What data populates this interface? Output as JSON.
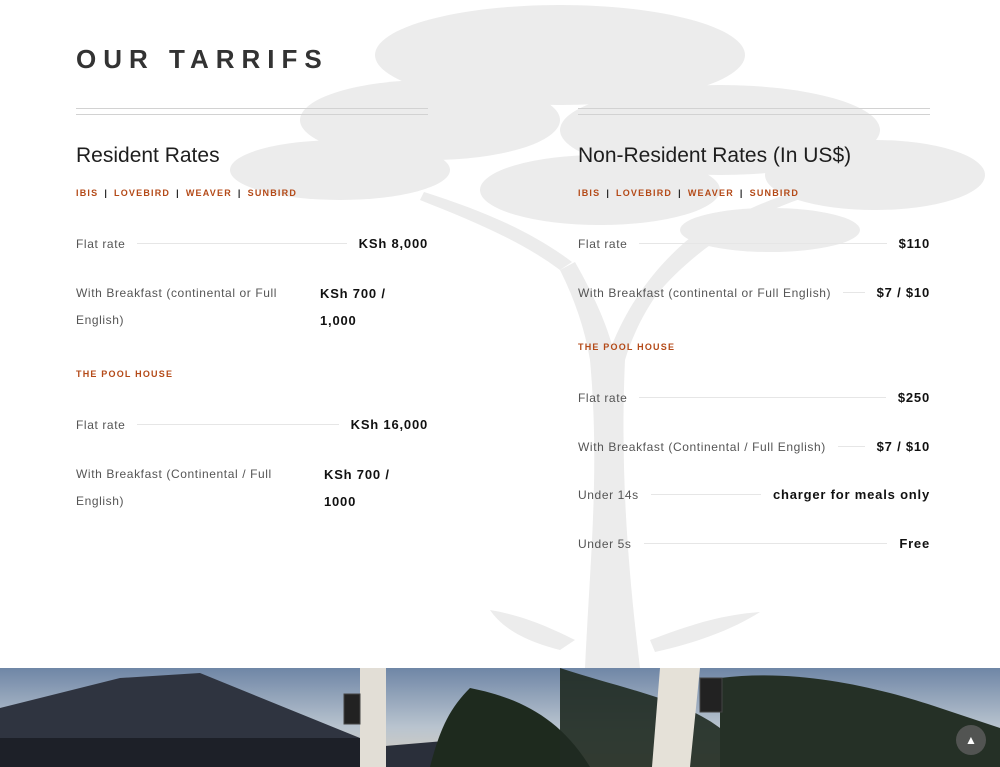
{
  "page": {
    "title": "OUR TARRIFS"
  },
  "resident": {
    "heading": "Resident Rates",
    "links": [
      "IBIS",
      "LOVEBIRD",
      "WEAVER",
      "SUNBIRD"
    ],
    "rates": [
      {
        "label": "Flat rate",
        "price": "KSh 8,000"
      },
      {
        "label": "With Breakfast (continental or Full English)",
        "price": "KSh 700 / 1,000"
      }
    ],
    "pool_house": {
      "label": "THE POOL HOUSE",
      "rates": [
        {
          "label": "Flat rate",
          "price": "KSh 16,000"
        },
        {
          "label": "With Breakfast (Continental / Full English)",
          "price": "KSh 700 / 1000"
        }
      ]
    }
  },
  "non_resident": {
    "heading": "Non-Resident Rates (In US$)",
    "links": [
      "IBIS",
      "LOVEBIRD",
      "WEAVER",
      "SUNBIRD"
    ],
    "rates": [
      {
        "label": "Flat rate",
        "price": "$110"
      },
      {
        "label": "With Breakfast (continental or Full English)",
        "price": "$7 / $10"
      }
    ],
    "pool_house": {
      "label": "THE POOL HOUSE",
      "rates": [
        {
          "label": "Flat rate",
          "price": "$250"
        },
        {
          "label": "With Breakfast (Continental / Full English)",
          "price": "$7 / $10"
        },
        {
          "label": "Under 14s",
          "price": "charger for meals only"
        },
        {
          "label": "Under 5s",
          "price": "Free"
        }
      ]
    }
  },
  "icons": {
    "scroll_top": "chevron-up-icon"
  }
}
